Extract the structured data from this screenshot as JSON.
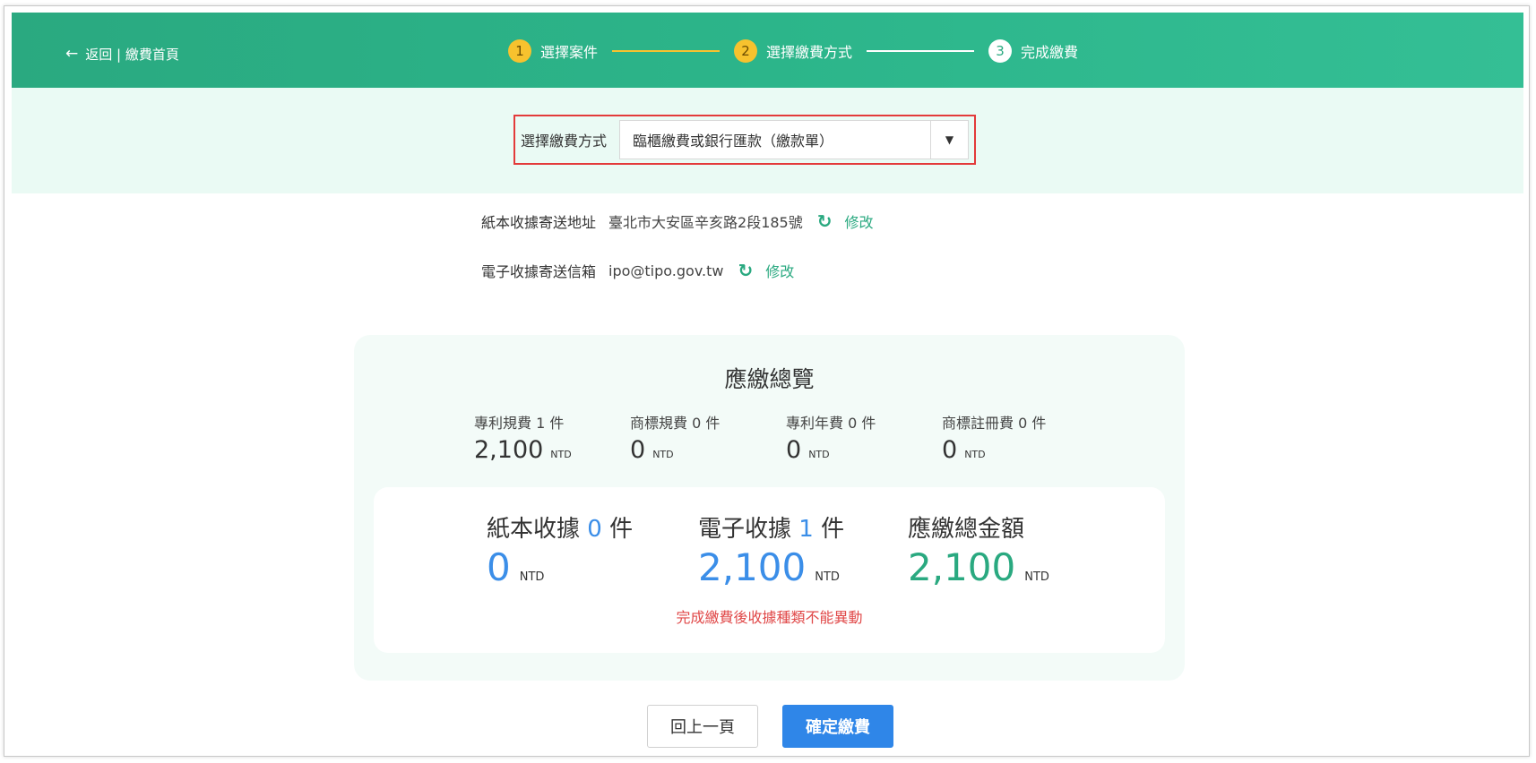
{
  "header": {
    "back_label": "返回 | 繳費首頁",
    "steps": [
      {
        "num": "1",
        "label": "選擇案件"
      },
      {
        "num": "2",
        "label": "選擇繳費方式"
      },
      {
        "num": "3",
        "label": "完成繳費"
      }
    ]
  },
  "payment_select": {
    "label": "選擇繳費方式",
    "value": "臨櫃繳費或銀行匯款（繳款單）"
  },
  "info": {
    "paper_receipt_label": "紙本收據寄送地址",
    "paper_receipt_value": "臺北市大安區辛亥路2段185號",
    "email_receipt_label": "電子收據寄送信箱",
    "email_receipt_value": "ipo@tipo.gov.tw",
    "edit_label": "修改"
  },
  "summary": {
    "title": "應繳總覽",
    "fees": [
      {
        "label": "專利規費 1 件",
        "amount": "2,100",
        "unit": "NTD"
      },
      {
        "label": "商標規費 0 件",
        "amount": "0",
        "unit": "NTD"
      },
      {
        "label": "專利年費 0 件",
        "amount": "0",
        "unit": "NTD"
      },
      {
        "label": "商標註冊費 0 件",
        "amount": "0",
        "unit": "NTD"
      }
    ],
    "totals": {
      "paper": {
        "label_prefix": "紙本收據 ",
        "count": "0",
        "label_suffix": " 件",
        "amount": "0",
        "unit": "NTD"
      },
      "electronic": {
        "label_prefix": "電子收據 ",
        "count": "1",
        "label_suffix": " 件",
        "amount": "2,100",
        "unit": "NTD"
      },
      "grand": {
        "label": "應繳總金額",
        "amount": "2,100",
        "unit": "NTD"
      }
    },
    "warning": "完成繳費後收據種類不能異動"
  },
  "buttons": {
    "back": "回上一頁",
    "confirm": "確定繳費"
  },
  "colors": {
    "header_green": "#2aa980",
    "accent_blue": "#3b8ee8",
    "step_active": "#f7c22e",
    "warning_red": "#e04848"
  }
}
